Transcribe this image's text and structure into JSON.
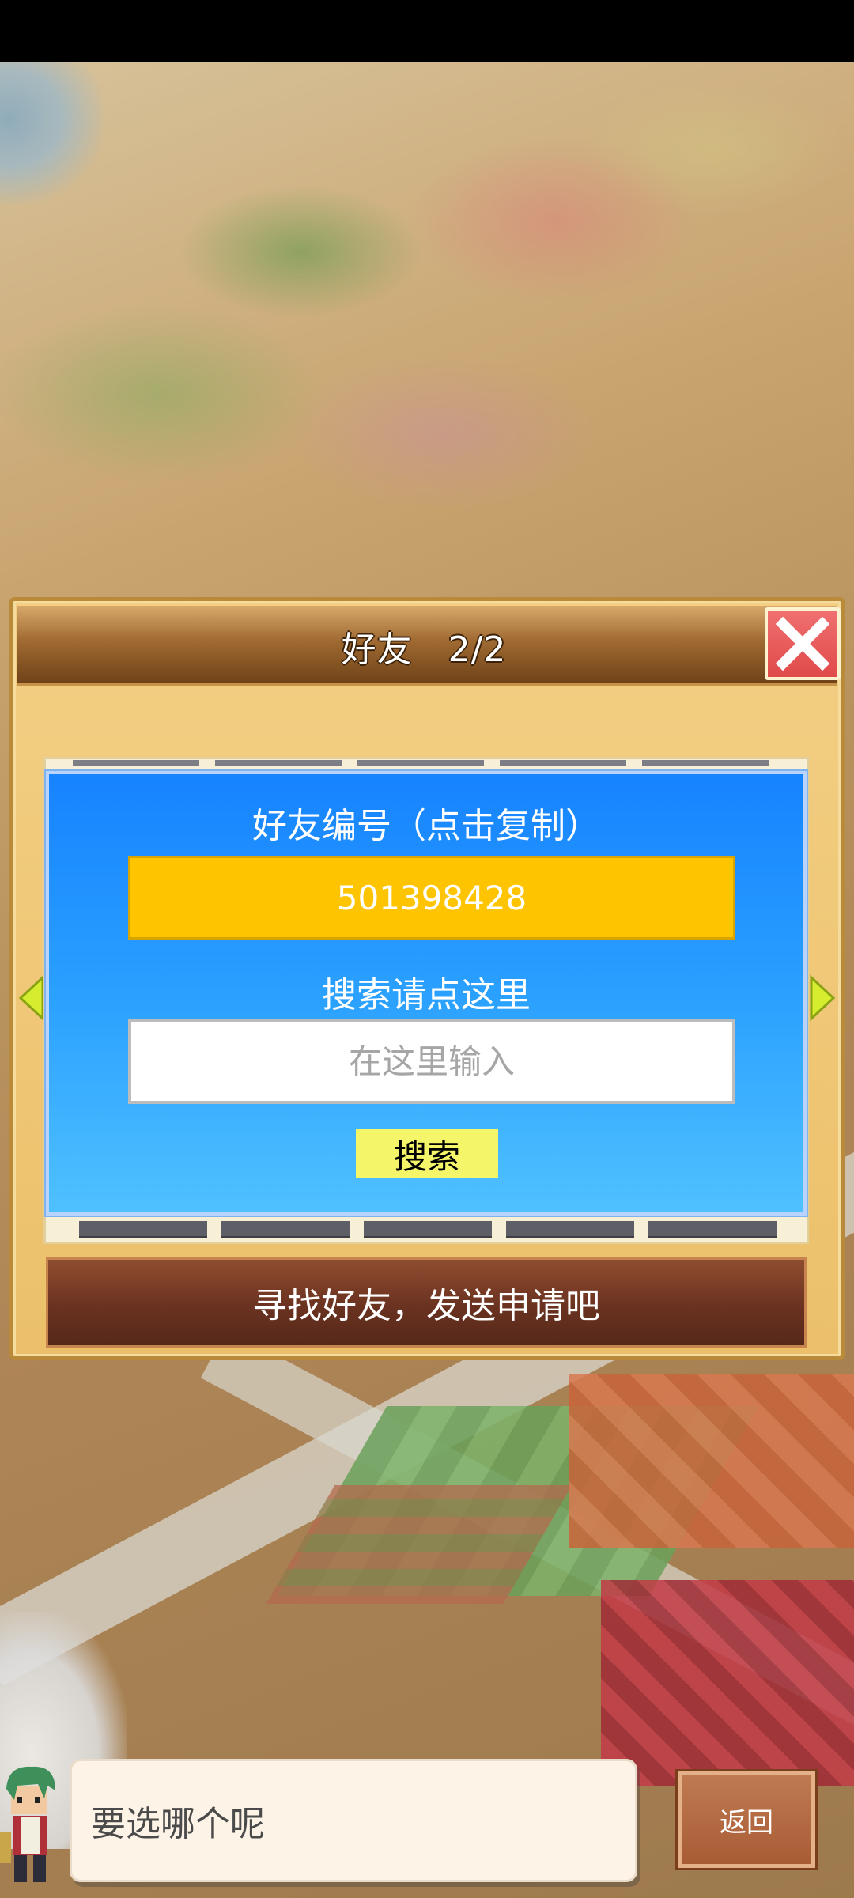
{
  "dialog": {
    "title": "好友　2/2",
    "close_icon": "close-x-icon",
    "accent_color": "#ffc400",
    "panel_color": "#1683ff"
  },
  "friend_id": {
    "label": "好友编号（点击复制）",
    "value": "501398428"
  },
  "search": {
    "label": "搜索请点这里",
    "placeholder": "在这里输入",
    "button_label": "搜索"
  },
  "find_friends_label": "寻找好友，发送申请吧",
  "navigation": {
    "left_icon": "arrow-left-icon",
    "right_icon": "arrow-right-icon"
  },
  "message": {
    "text": "要选哪个呢",
    "avatar_icon": "green-haired-character-avatar"
  },
  "back_button_label": "返回"
}
